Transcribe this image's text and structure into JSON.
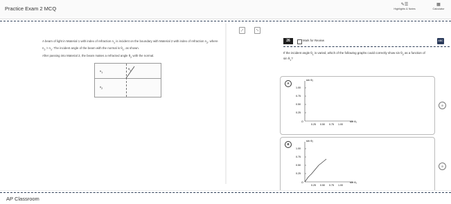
{
  "header": {
    "exam_title": "Practice Exam 2 MCQ",
    "highlights_label": "Highlights & Notes",
    "calculator_label": "Calculator"
  },
  "passage": {
    "para1_a": "A beam of light in Material 1 with index of refraction n",
    "para1_b": " is incident on the boundary with Material 2 with",
    "para1_c": "index of refraction n",
    "para1_d": ", where n",
    "para1_e": " > n",
    "para1_f": ". The incident angle of the beam with the normal is θ",
    "para1_g": ", as shown.",
    "para2_a": "After passing into Material 2, the beam makes a refracted angle θ",
    "para2_b": " with the normal.",
    "sub1": "1",
    "sub2": "2",
    "diagram_n1": "n",
    "diagram_n2": "n",
    "diagram_theta": "θ"
  },
  "question": {
    "number": "26",
    "mark_label": "Mark for Review",
    "abc_label": "ABC",
    "stem_a": "If the incident angle θ",
    "stem_b": " is varied, which of the following graphs could correctly show sin θ",
    "stem_c": " as a function of",
    "stem_d": "sin θ",
    "stem_e": "?"
  },
  "choices": [
    {
      "letter": "A",
      "ylabel": "sin θ₂",
      "xlabel": "sin θ₁",
      "origin": "O",
      "yticks": [
        "1.00",
        "0.75",
        "0.50",
        "0.25"
      ],
      "xticks": [
        "0.25",
        "0.50",
        "0.75",
        "1.00"
      ]
    },
    {
      "letter": "B",
      "ylabel": "sin θ₂",
      "xlabel": "sin θ₁",
      "origin": "O",
      "yticks": [
        "1.00",
        "0.75",
        "0.50",
        "0.25"
      ],
      "xticks": [
        "0.25",
        "0.50",
        "0.75",
        "1.00"
      ]
    }
  ],
  "footer": {
    "logo": "AP Classroom"
  },
  "colors": {
    "dash": "#2f3f59",
    "qnum_bg": "#1e1e1e",
    "accent": "#2a3a5a"
  }
}
